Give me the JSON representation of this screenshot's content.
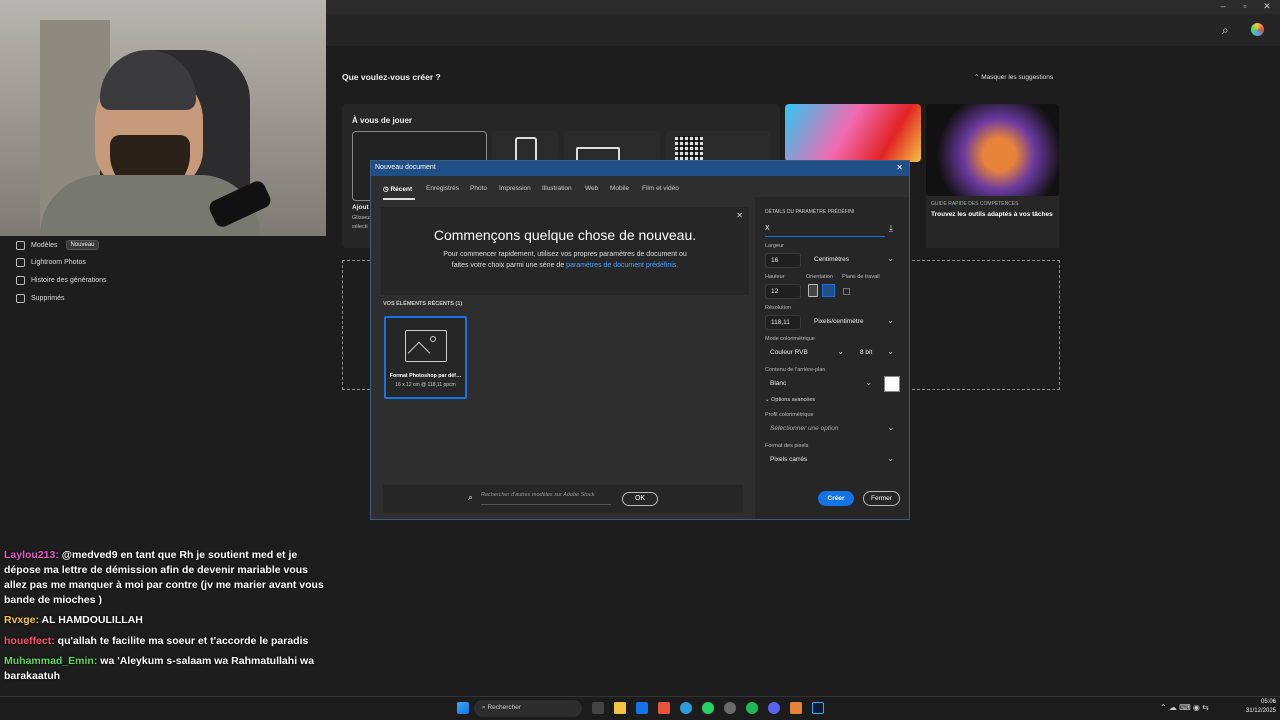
{
  "sidebar": {
    "items": [
      {
        "label": "Modèles",
        "badge": "Nouveau"
      },
      {
        "label": "Lightroom Photos"
      },
      {
        "label": "Histoire des générations"
      },
      {
        "label": "Supprimés"
      }
    ]
  },
  "home": {
    "heading": "Que voulez-vous créer ?",
    "hide_suggestions": "Masquer les suggestions",
    "play_label": "À vous de jouer",
    "card_left_text_1": "Ajout",
    "card_left_text_2": "Glissez",
    "card_left_text_3": "sélecti",
    "guide_label": "GUIDE RAPIDE DES COMPÉTENCES",
    "guide_title": "Trouvez les outils adaptés à vos tâches"
  },
  "dialog": {
    "title": "Nouveau document",
    "tabs": [
      "Récent",
      "Enregistrés",
      "Photo",
      "Impression",
      "Illustration",
      "Web",
      "Mobile",
      "Film et vidéo"
    ],
    "intro_title": "Commençons quelque chose de nouveau.",
    "intro_text_1": "Pour commencer rapidement, utilisez vos propres paramètres de document ou",
    "intro_text_2": "faites votre choix parmi une série de",
    "intro_link": "paramètres de document prédéfinis.",
    "recent_header": "VOS ÉLÉMENTS RÉCENTS  (1)",
    "recent_item_name": "Format Photoshop par déf…",
    "recent_item_size": "16 x 12 cm @ 118,11 ppcm",
    "search_placeholder": "Rechercher d'autres modèles sur Adobe Stock",
    "ok_label": "OK",
    "preset_header": "DÉTAILS DU PARAMÈTRE PRÉDÉFINI",
    "preset_name": "X",
    "width_label": "Largeur",
    "width_value": "16",
    "width_unit": "Centimètres",
    "height_label": "Hauteur",
    "height_value": "12",
    "orientation_label": "Orientation",
    "artboards_label": "Plans de travail",
    "resolution_label": "Résolution",
    "resolution_value": "118,11",
    "resolution_unit": "Pixels/centimètre",
    "color_mode_label": "Mode colorimétrique",
    "color_mode_value": "Couleur RVB",
    "bit_depth": "8 bit",
    "background_label": "Contenu de l'arrière-plan",
    "background_value": "Blanc",
    "advanced_label": "Options avancées",
    "profile_label": "Profil colorimétrique",
    "profile_value": "Sélectionner une option",
    "pixel_format_label": "Format des pixels",
    "pixel_format_value": "Pixels carrés",
    "create_label": "Créer",
    "close_label": "Fermer"
  },
  "chat": [
    {
      "user": "Laylou213:",
      "user_color": "#e05cc4",
      "text": "@medved9 en tant que Rh je soutient med et je dépose ma lettre de démission afin de devenir mariable vous allez pas me manquer à moi par contre (jv me marier avant vous bande de mioches )"
    },
    {
      "user": "Rvxge:",
      "user_color": "#f5c542",
      "text": "AL HAMDOULILLAH"
    },
    {
      "user": "houeffect:",
      "user_color": "#ff4d6a",
      "text": "qu'allah te facilite ma soeur et t'accorde le paradis"
    },
    {
      "user": "Muhammad_Emin:",
      "user_color": "#5cd65c",
      "text": "wa 'Aleykum s-salaam wa Rahmatullahi wa barakaatuh"
    }
  ],
  "taskbar": {
    "search_placeholder": "Rechercher",
    "time": "05:06",
    "date": "31/12/2025"
  },
  "colors": {
    "accent": "#1473e6",
    "dialog_title": "#1f4f86"
  }
}
